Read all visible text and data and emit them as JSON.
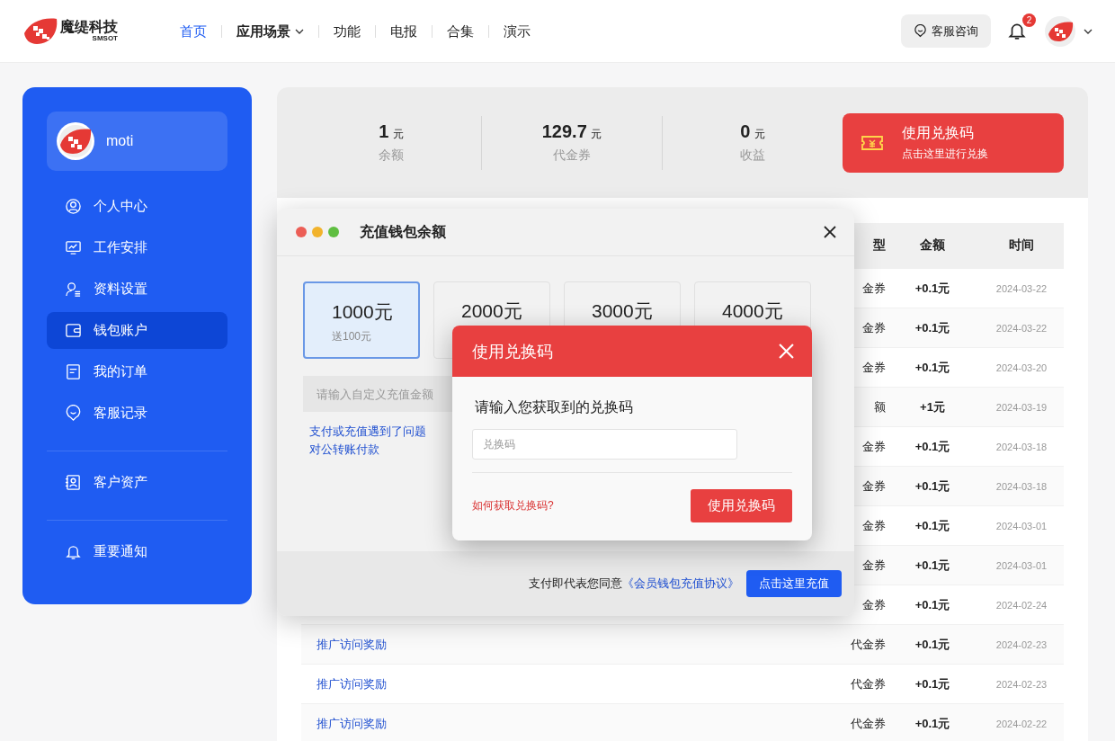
{
  "header": {
    "brand": {
      "name": "魔缇科技",
      "sub": "SMSOT"
    },
    "nav": [
      {
        "label": "首页",
        "selected": true,
        "dropdown": false
      },
      {
        "label": "应用场景",
        "selected": false,
        "dropdown": true
      },
      {
        "label": "功能",
        "selected": false,
        "dropdown": false
      },
      {
        "label": "电报",
        "selected": false,
        "dropdown": false
      },
      {
        "label": "合集",
        "selected": false,
        "dropdown": false
      },
      {
        "label": "演示",
        "selected": false,
        "dropdown": false
      }
    ],
    "support_button": "客服咨询",
    "notification_badge": "2"
  },
  "sidebar": {
    "user": "moti",
    "groups": [
      {
        "items": [
          {
            "label": "个人中心",
            "selected": false
          },
          {
            "label": "工作安排",
            "selected": false
          },
          {
            "label": "资料设置",
            "selected": false
          },
          {
            "label": "钱包账户",
            "selected": true
          },
          {
            "label": "我的订单",
            "selected": false
          },
          {
            "label": "客服记录",
            "selected": false
          }
        ]
      },
      {
        "items": [
          {
            "label": "客户资产",
            "selected": false
          }
        ]
      },
      {
        "items": [
          {
            "label": "重要通知",
            "selected": false
          }
        ]
      }
    ]
  },
  "summary": {
    "stats": [
      {
        "value": "1",
        "unit": "元",
        "label": "余额"
      },
      {
        "value": "129.7",
        "unit": "元",
        "label": "代金券"
      },
      {
        "value": "0",
        "unit": "元",
        "label": "收益"
      }
    ],
    "redeem_button": {
      "title": "使用兑换码",
      "subtitle": "点击这里进行兑换"
    }
  },
  "table": {
    "columns": [
      "型",
      "金额",
      "时间"
    ],
    "rows": [
      {
        "type": "金券",
        "amount": "+0.1元",
        "date": "2024-03-22"
      },
      {
        "type": "金券",
        "amount": "+0.1元",
        "date": "2024-03-22"
      },
      {
        "type": "金券",
        "amount": "+0.1元",
        "date": "2024-03-20"
      },
      {
        "type": "额",
        "amount": "+1元",
        "date": "2024-03-19"
      },
      {
        "type": "金券",
        "amount": "+0.1元",
        "date": "2024-03-18"
      },
      {
        "type": "金券",
        "amount": "+0.1元",
        "date": "2024-03-18"
      },
      {
        "type": "金券",
        "amount": "+0.1元",
        "date": "2024-03-01"
      },
      {
        "type": "金券",
        "amount": "+0.1元",
        "date": "2024-03-01"
      },
      {
        "type": "金券",
        "amount": "+0.1元",
        "date": "2024-02-24"
      },
      {
        "name": "推广访问奖励",
        "type": "代金券",
        "amount": "+0.1元",
        "date": "2024-02-23"
      },
      {
        "name": "推广访问奖励",
        "type": "代金券",
        "amount": "+0.1元",
        "date": "2024-02-23"
      },
      {
        "name": "推广访问奖励",
        "type": "代金券",
        "amount": "+0.1元",
        "date": "2024-02-22"
      }
    ]
  },
  "recharge_dialog": {
    "title": "充值钱包余额",
    "options": [
      {
        "amount": "1000元",
        "bonus": "送100元",
        "selected": true
      },
      {
        "amount": "2000元",
        "selected": false
      },
      {
        "amount": "3000元",
        "selected": false
      },
      {
        "amount": "4000元",
        "selected": false
      }
    ],
    "custom_amount": {
      "placeholder": "请输入自定义充值金额"
    },
    "links": [
      "支付或充值遇到了问题",
      "对公转账付款"
    ],
    "agreement": {
      "text": "支付即代表您同意",
      "link": "《会员钱包充值协议》"
    },
    "submit": "点击这里充值"
  },
  "redeem_dialog": {
    "title": "使用兑换码",
    "prompt": "请输入您获取到的兑换码",
    "code": {
      "placeholder": "兑换码"
    },
    "help_link": "如何获取兑换码?",
    "submit": "使用兑换码"
  }
}
